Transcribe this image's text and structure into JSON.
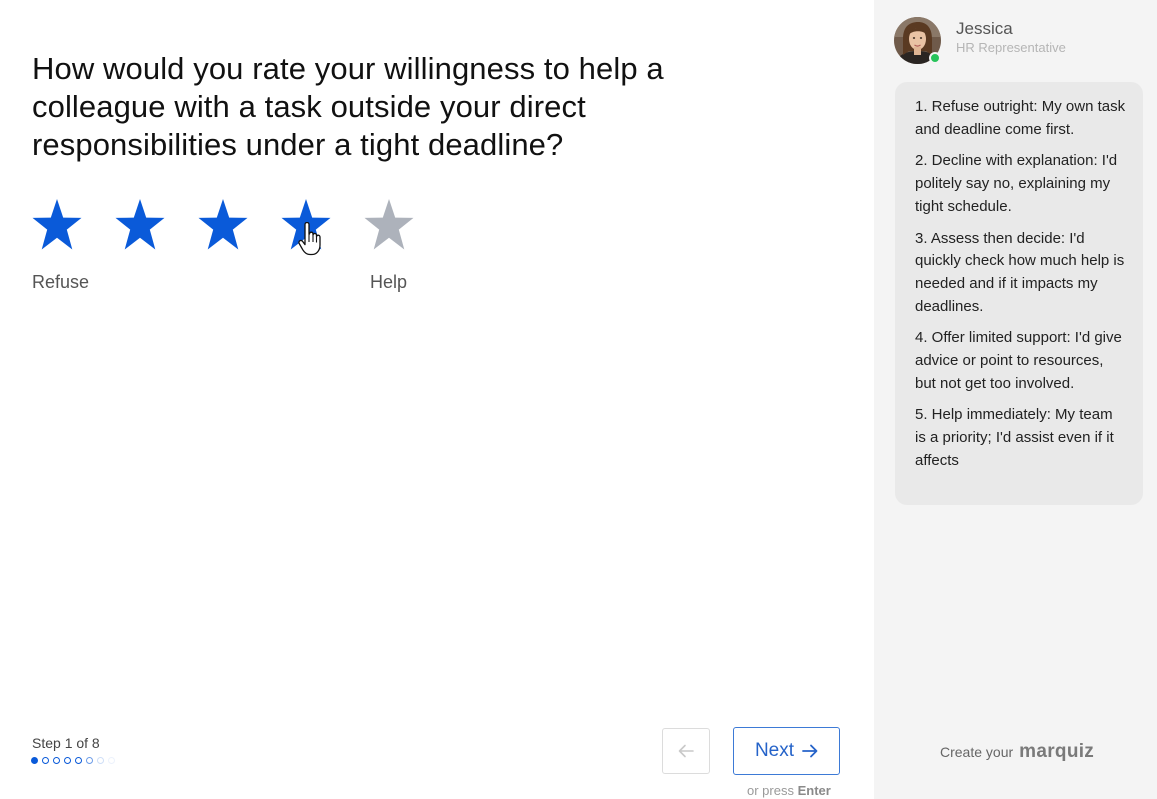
{
  "question": {
    "text": "How would you rate your willingness to help a colleague with a task outside your direct responsibilities under a tight deadline?"
  },
  "rating": {
    "max": 5,
    "selected": 4,
    "min_label": "Refuse",
    "max_label": "Help",
    "filled_color": "#0a5ad9",
    "empty_color": "#adb2bb"
  },
  "progress": {
    "step_text": "Step 1 of 8",
    "current": 1,
    "total": 8
  },
  "navigation": {
    "back_icon": "arrow-left-icon",
    "next_label": "Next",
    "next_icon": "arrow-right-icon",
    "hint_prefix": "or press",
    "hint_key": "Enter"
  },
  "agent": {
    "name": "Jessica",
    "role": "HR Representative",
    "status": "online",
    "avatar_icon": "avatar-photo",
    "messages": [
      "1. Refuse outright: My own task and deadline come first.",
      "2. Decline with explanation: I'd politely say no, explaining my tight schedule.",
      "3. Assess then decide: I'd quickly check how much help is needed and if it impacts my deadlines.",
      "4. Offer limited support: I'd give advice or point to resources, but not get too involved.",
      "5. Help immediately: My team is a priority; I'd assist even if it affects"
    ]
  },
  "branding": {
    "prefix": "Create your",
    "name": "marquiz"
  },
  "colors": {
    "accent": "#0a5ad9",
    "sidebar_bg": "#f4f4f4",
    "bubble_bg": "#e9e9e9",
    "online": "#27c35a"
  }
}
